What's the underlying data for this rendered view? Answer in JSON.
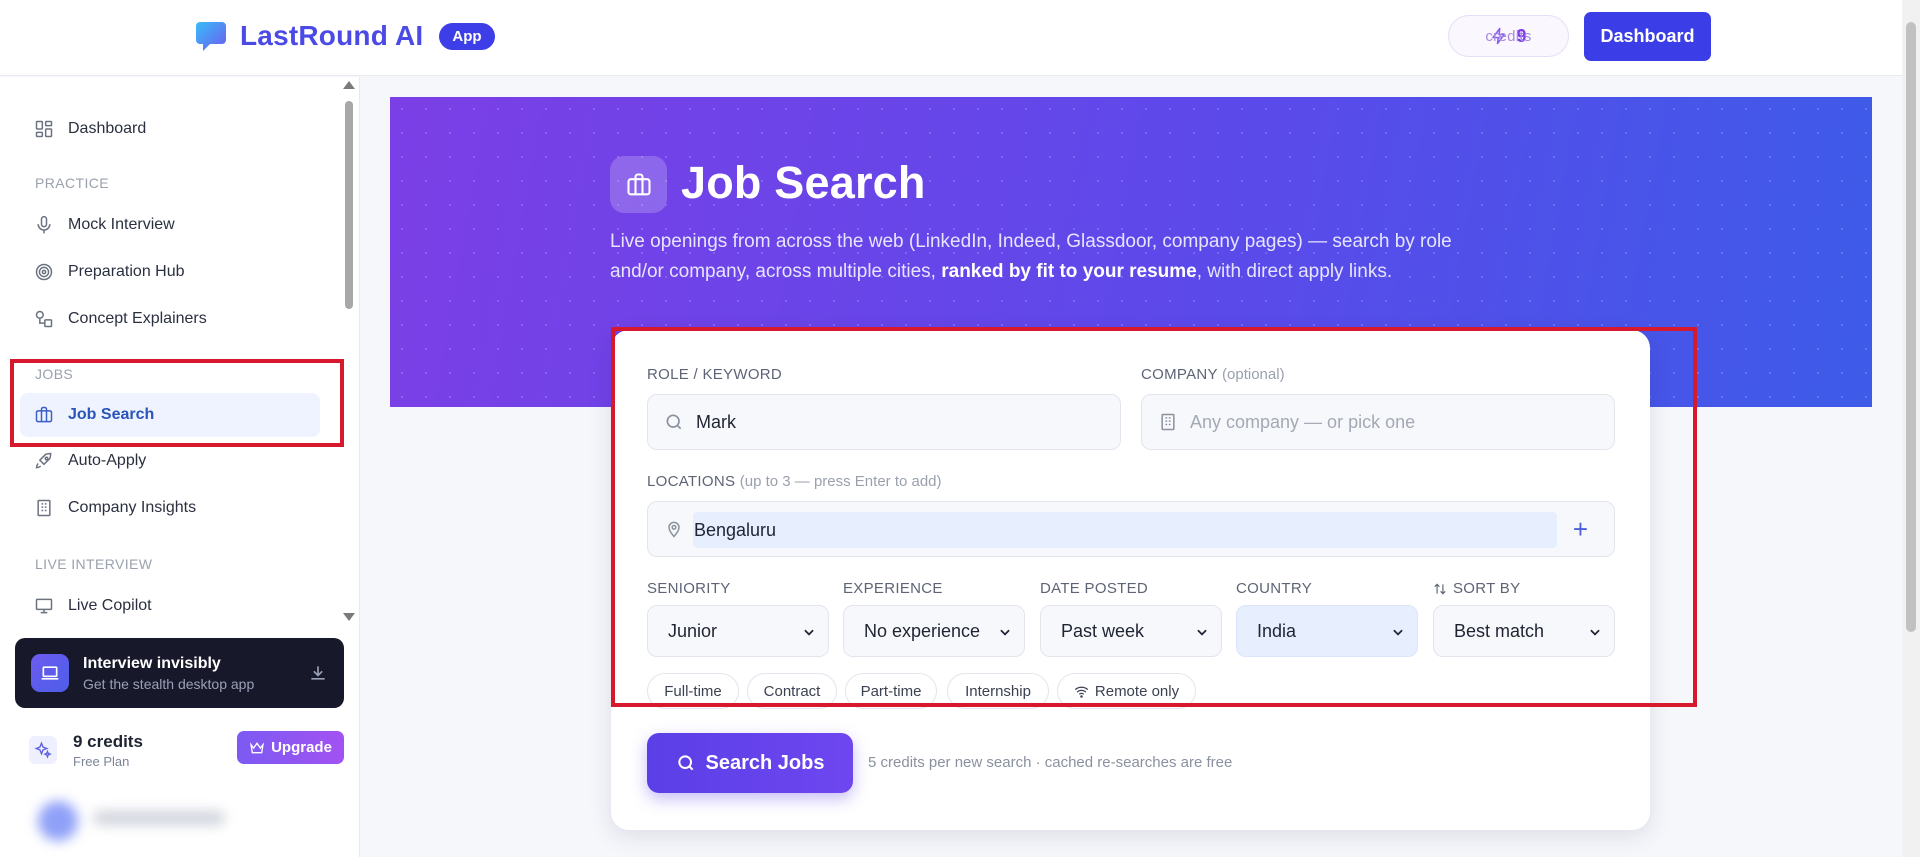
{
  "header": {
    "brand_name": "LastRound AI",
    "brand_badge": "App",
    "credits_count": "9",
    "credits_label": "credits",
    "dashboard_button": "Dashboard"
  },
  "sidebar": {
    "dashboard": "Dashboard",
    "section_practice": "PRACTICE",
    "mock_interview": "Mock Interview",
    "preparation_hub": "Preparation Hub",
    "concept_explainers": "Concept Explainers",
    "section_jobs": "JOBS",
    "job_search": "Job Search",
    "auto_apply": "Auto-Apply",
    "company_insights": "Company Insights",
    "section_live": "LIVE INTERVIEW",
    "live_copilot": "Live Copilot",
    "promo_title": "Interview invisibly",
    "promo_subtitle": "Get the stealth desktop app",
    "plan_credits": "9 credits",
    "plan_name": "Free Plan",
    "upgrade_button": "Upgrade"
  },
  "hero": {
    "title": "Job Search",
    "desc_part1": "Live openings from across the web (LinkedIn, Indeed, Glassdoor, company pages) — search by role and/or company, across multiple cities, ",
    "desc_bold": "ranked by fit to your resume",
    "desc_part2": ", with direct apply links."
  },
  "form": {
    "role_label": "ROLE / KEYWORD",
    "role_value": "Mark",
    "company_label": "COMPANY",
    "company_label_hint": "(optional)",
    "company_placeholder": "Any company — or pick one",
    "locations_label": "LOCATIONS",
    "locations_hint": "(up to 3 — press Enter to add)",
    "location_value": "Bengaluru",
    "add_symbol": "+",
    "seniority_label": "SENIORITY",
    "seniority_value": "Junior",
    "experience_label": "EXPERIENCE",
    "experience_value": "No experience",
    "date_label": "DATE POSTED",
    "date_value": "Past week",
    "country_label": "COUNTRY",
    "country_value": "India",
    "sort_label": "SORT BY",
    "sort_value": "Best match",
    "chips": [
      "Full-time",
      "Contract",
      "Part-time",
      "Internship",
      "Remote only"
    ],
    "search_button": "Search Jobs",
    "search_note": "5 credits per new search · cached re-searches are free"
  },
  "colors": {
    "accent": "#3b3ee6",
    "hero_start": "#7b3fe6",
    "hero_end": "#3d5be8",
    "highlight": "#d7192d"
  }
}
